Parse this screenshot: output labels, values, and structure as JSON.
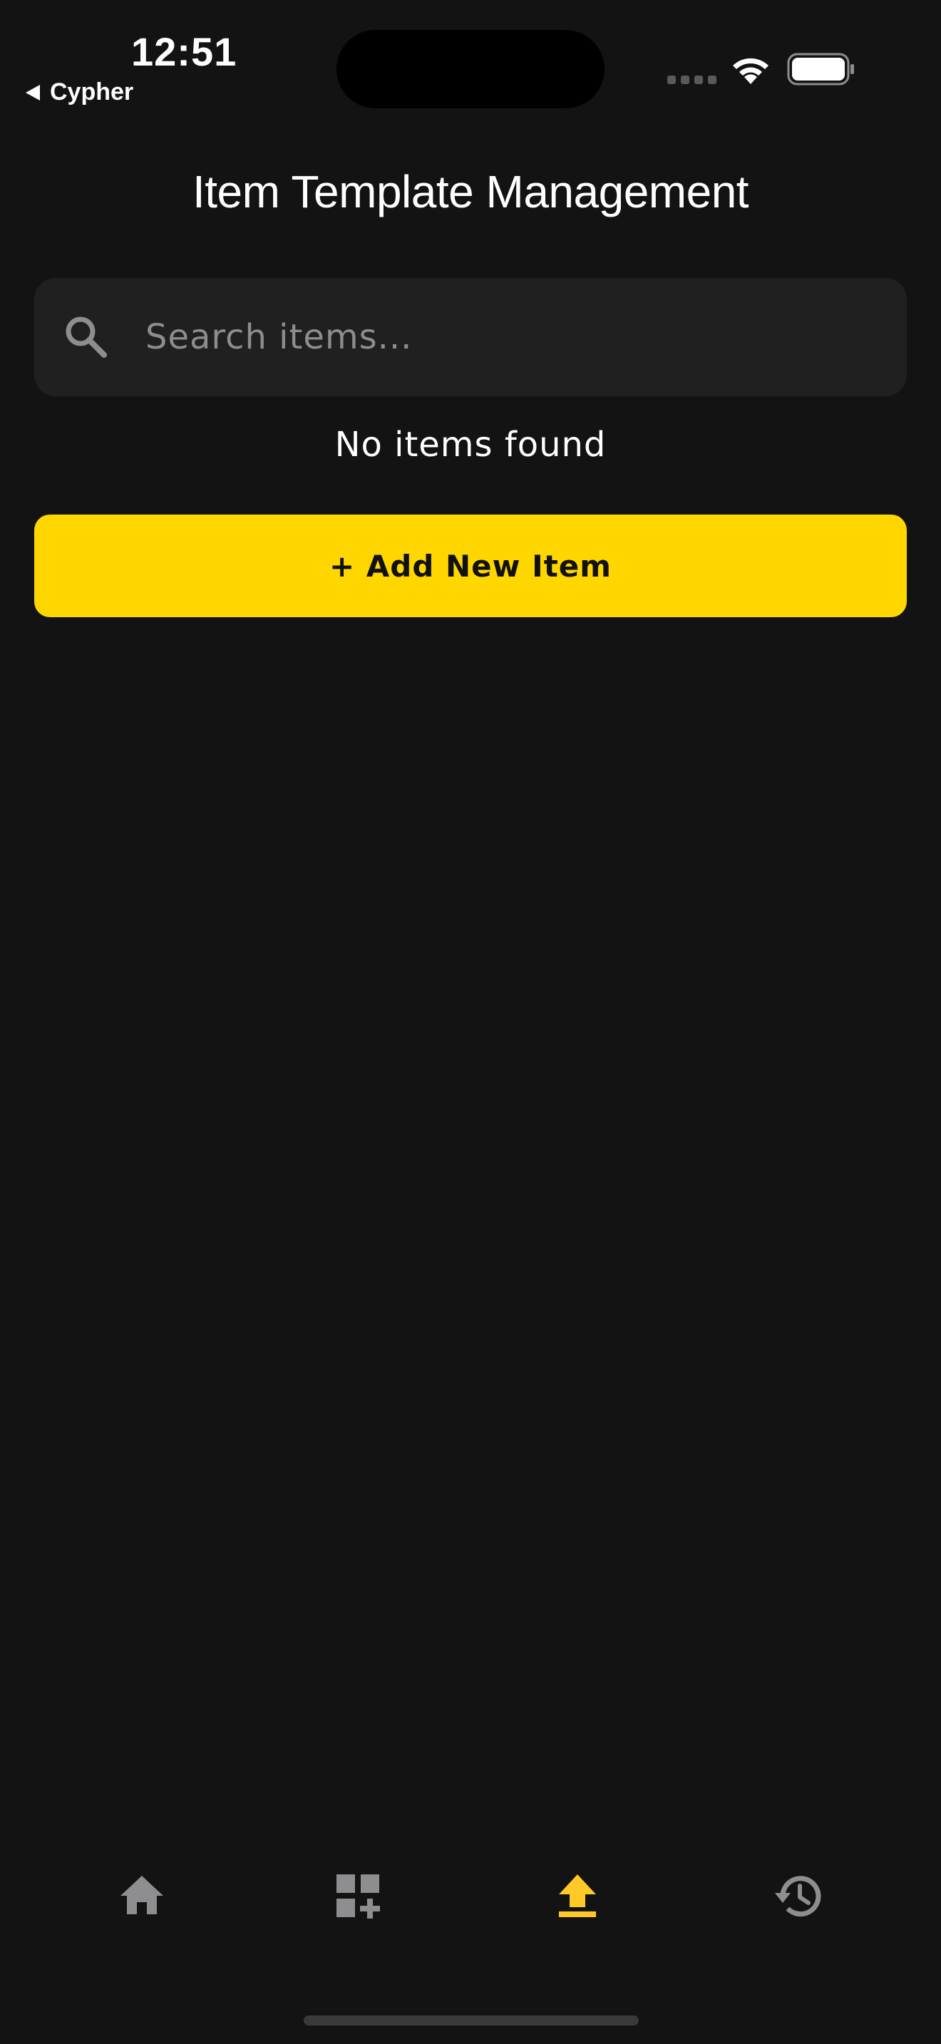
{
  "status_bar": {
    "time": "12:51",
    "back_app": "Cypher"
  },
  "page": {
    "title": "Item Template Management"
  },
  "search": {
    "placeholder": "Search items...",
    "value": ""
  },
  "empty_state": {
    "message": "No items found"
  },
  "actions": {
    "add_label": "+ Add New Item"
  },
  "bottom_nav": {
    "items": [
      {
        "icon": "home-icon",
        "active": false
      },
      {
        "icon": "add-grid-icon",
        "active": false
      },
      {
        "icon": "upload-icon",
        "active": true
      },
      {
        "icon": "history-icon",
        "active": false
      }
    ]
  },
  "colors": {
    "background": "#131314",
    "surface": "#202021",
    "accent": "#ffd600",
    "nav_inactive": "#8e8e90",
    "nav_active": "#ffc928"
  }
}
